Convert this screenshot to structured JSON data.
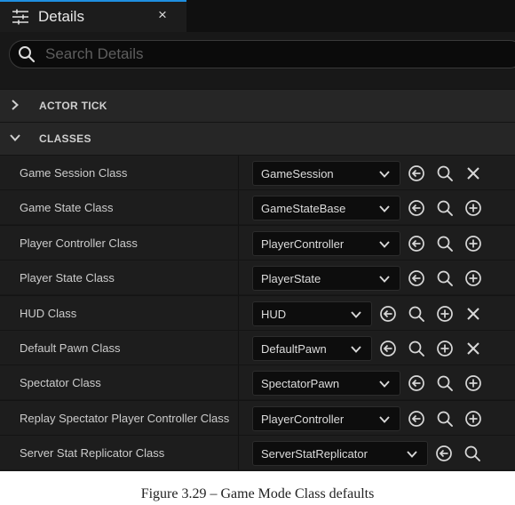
{
  "tab": {
    "title": "Details",
    "close": "×"
  },
  "search": {
    "placeholder": "Search Details",
    "value": ""
  },
  "sections": [
    {
      "label": "ACTOR TICK",
      "expanded": false
    },
    {
      "label": "CLASSES",
      "expanded": true
    }
  ],
  "rows": [
    {
      "name": "Game Session Class",
      "value": "GameSession",
      "actions": [
        "use-selected",
        "browse",
        "clear"
      ]
    },
    {
      "name": "Game State Class",
      "value": "GameStateBase",
      "actions": [
        "use-selected",
        "browse",
        "create"
      ]
    },
    {
      "name": "Player Controller Class",
      "value": "PlayerController",
      "actions": [
        "use-selected",
        "browse",
        "create"
      ]
    },
    {
      "name": "Player State Class",
      "value": "PlayerState",
      "actions": [
        "use-selected",
        "browse",
        "create"
      ]
    },
    {
      "name": "HUD Class",
      "value": "HUD",
      "actions": [
        "use-selected",
        "browse",
        "create",
        "clear"
      ]
    },
    {
      "name": "Default Pawn Class",
      "value": "DefaultPawn",
      "actions": [
        "use-selected",
        "browse",
        "create",
        "clear"
      ]
    },
    {
      "name": "Spectator Class",
      "value": "SpectatorPawn",
      "actions": [
        "use-selected",
        "browse",
        "create"
      ]
    },
    {
      "name": "Replay Spectator Player Controller Class",
      "value": "PlayerController",
      "actions": [
        "use-selected",
        "browse",
        "create"
      ]
    },
    {
      "name": "Server Stat Replicator Class",
      "value": "ServerStatReplicator",
      "actions": [
        "use-selected",
        "browse"
      ]
    }
  ],
  "caption": "Figure 3.29 – Game Mode Class defaults",
  "colors": {
    "panel": "#181818",
    "row": "#1d1d1d",
    "header": "#262626",
    "accent": "#1f8fe0",
    "text": "#cccccc"
  }
}
